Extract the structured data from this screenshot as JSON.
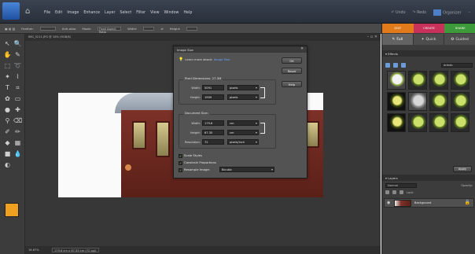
{
  "menu": {
    "items": [
      "File",
      "Edit",
      "Image",
      "Enhance",
      "Layer",
      "Select",
      "Filter",
      "View",
      "Window",
      "Help"
    ],
    "undo": "Undo",
    "redo": "Redo",
    "organizer": "Organizer",
    "minimize": "–"
  },
  "options": {
    "feather": "Feather:",
    "antialias": "Anti-alias",
    "mode_label": "Mode:",
    "mode_value": "Fixed Aspect Ratio",
    "width": "Width:",
    "height": "Height:"
  },
  "document": {
    "tab_title": "IMG_5211.JPG @ 16% (RGB/8)",
    "zoom": "16.67%",
    "dimensions": "179.6 cm x 67.35 cm (72 ppi)"
  },
  "dialog": {
    "title": "Image Size",
    "learn_prefix": "Learn more about:",
    "learn_link": "Image Size",
    "ok": "OK",
    "reset": "Reset",
    "help": "Help",
    "pixel_dimensions": "Pixel Dimensions: 27.3M",
    "px_width_label": "Width:",
    "px_width_value": "5091",
    "px_width_unit": "pixels",
    "px_height_label": "Height:",
    "px_height_value": "1909",
    "px_height_unit": "pixels",
    "document_size": "Document Size:",
    "doc_width_label": "Width:",
    "doc_width_value": "179.6",
    "doc_width_unit": "cm",
    "doc_height_label": "Height:",
    "doc_height_value": "67.35",
    "doc_height_unit": "cm",
    "resolution_label": "Resolution:",
    "resolution_value": "72",
    "resolution_unit": "pixels/inch",
    "scale_styles": "Scale Styles",
    "constrain": "Constrain Proportions",
    "resample": "Resample Image:",
    "resample_value": "Bicubic"
  },
  "panel": {
    "tab_edit": "EDIT",
    "tab_create": "CREATE",
    "tab_share": "SHARE",
    "full": "Full",
    "quick": "Quick",
    "guided": "Guided",
    "effects_title": "Effects",
    "filter_dropdown": "Artistic",
    "apply": "Apply",
    "layers_title": "Layers",
    "blend_mode": "Normal",
    "opacity_label": "Opacity:",
    "lock_label": "Lock:",
    "layer_name": "Background"
  },
  "colors": {
    "foreground": "#f0a020",
    "background": "#ffffff",
    "edit_tab": "#e07a1a",
    "create_tab": "#c8325a",
    "share_tab": "#3d9a3a"
  }
}
